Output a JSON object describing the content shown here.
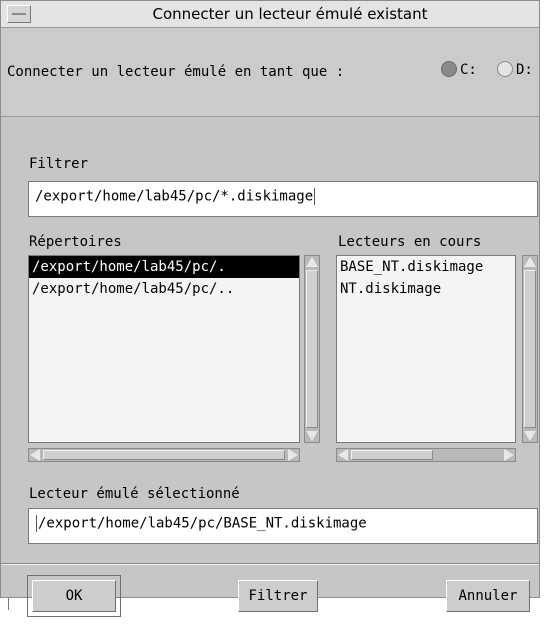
{
  "dialog": {
    "title": "Connecter un lecteur émulé existant",
    "connect_label": "Connecter un lecteur émulé en tant que :",
    "drive_options": [
      {
        "label": "C:",
        "selected": true
      },
      {
        "label": "D:",
        "selected": false
      }
    ],
    "filter": {
      "label": "Filtrer",
      "value": "/export/home/lab45/pc/*.diskimage"
    },
    "directories": {
      "label": "Répertoires",
      "items": [
        "/export/home/lab45/pc/.",
        "/export/home/lab45/pc/.."
      ],
      "selected_index": 0
    },
    "current_drives": {
      "label": "Lecteurs en cours",
      "items": [
        "BASE_NT.diskimage",
        "NT.diskimage"
      ]
    },
    "selection": {
      "label": "Lecteur émulé sélectionné",
      "value": "/export/home/lab45/pc/BASE_NT.diskimage"
    },
    "buttons": {
      "ok": "OK",
      "filter": "Filtrer",
      "cancel": "Annuler"
    }
  },
  "colors": {
    "dialog_bg": "#c6c6c6",
    "selection_bg": "#000000",
    "selection_fg": "#ffffff"
  }
}
